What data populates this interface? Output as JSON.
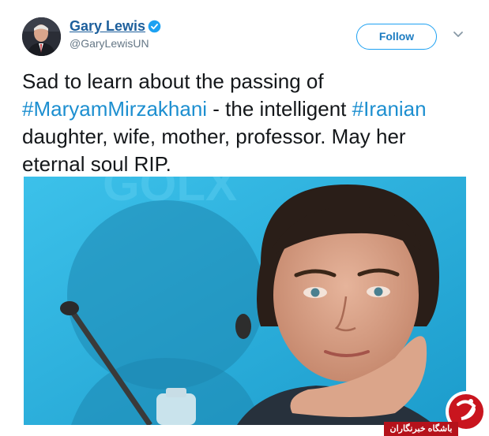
{
  "tweet": {
    "author": {
      "name": "Gary Lewis",
      "handle": "@GaryLewisUN",
      "verified": true
    },
    "follow_label": "Follow",
    "text": {
      "line1": "Sad to learn about the passing of",
      "hashtag1": "#MaryamMirzakhani",
      "line2_mid": " - the intelligent ",
      "hashtag2": "#Iranian",
      "line3": "daughter, wife, mother, professor. May her",
      "line4": "eternal soul RIP."
    }
  },
  "watermark": {
    "text": "باشگاه خبرنگاران"
  },
  "colors": {
    "link": "#1d8fd0",
    "name": "#1d5f9c",
    "verified": "#1da1f2",
    "photo_bg": "#31b6e2",
    "watermark_red": "#b5121b"
  },
  "icons": {
    "verified": "verified-badge-icon",
    "more": "chevron-down-icon"
  }
}
